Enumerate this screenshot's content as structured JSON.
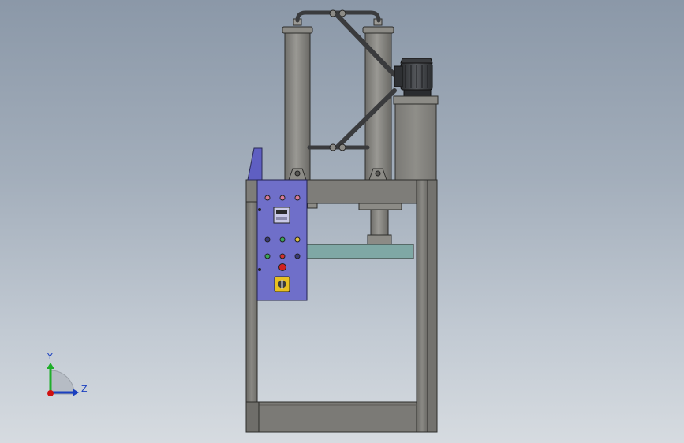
{
  "viewport": {
    "background_top": "#8b98a8",
    "background_bottom": "#d6dbe0"
  },
  "model": {
    "frame_color": "#7b7a76",
    "cylinder_color": "#8a8984",
    "motor_color": "#3b3d40",
    "control_panel_color": "#6f6fc9",
    "platen_color": "#7fa8a5",
    "indicator_lights": {
      "top_row": [
        "#d87a9a",
        "#d87a9a",
        "#d87a9a"
      ],
      "middle_row": [
        "#3a3a7a",
        "#3aa55a",
        "#e0c040"
      ],
      "lower_row": [
        "#3aa55a",
        "#d03030",
        "#3a3a7a"
      ],
      "emergency": "#d02020"
    },
    "selector_switch_color": "#e8c020"
  },
  "triad": {
    "y_label": "Y",
    "z_label": "Z",
    "y_color": "#1fae2a",
    "z_color": "#1a3fbf",
    "origin_color": "#d01010"
  }
}
